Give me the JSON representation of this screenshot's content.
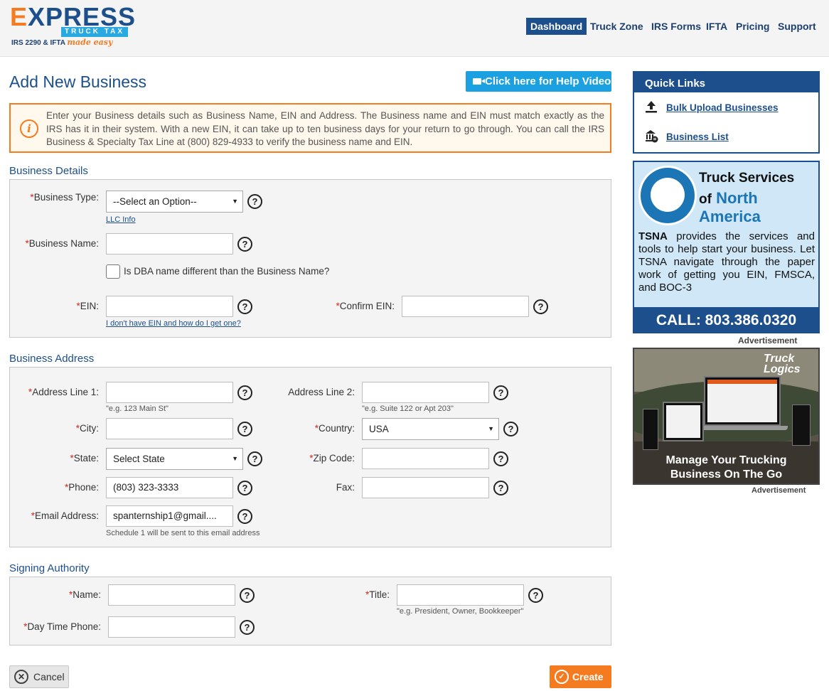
{
  "header": {
    "logo_main": "XPRESS",
    "logo_first": "E",
    "logo_band": "TRUCK TAX",
    "logo_sub": "IRS 2290 & IFTA",
    "logo_tagline": "made easy",
    "nav": [
      "Dashboard",
      "Truck Zone",
      "IRS Forms",
      "IFTA",
      "Pricing",
      "Support"
    ],
    "active_nav": "Dashboard"
  },
  "page": {
    "title": "Add New Business",
    "help_video_label": "Click here for Help Video",
    "notice": "Enter your Business details such as Business Name, EIN and Address. The Business name and EIN must match exactly as the IRS has it in their system. With a new EIN, it can take up to ten business days for your return to go through. You can call the IRS Business & Specialty Tax Line at (800) 829-4933 to verify the business name and EIN."
  },
  "business_details": {
    "heading": "Business Details",
    "business_type_label": "Business Type:",
    "business_type_value": "--Select an Option--",
    "llc_info_link": "LLC Info",
    "business_name_label": "Business Name:",
    "business_name_value": "",
    "dba_checkbox_label": "Is DBA name different than the Business Name?",
    "dba_checked": false,
    "ein_label": "EIN:",
    "ein_value": "",
    "confirm_ein_label": "Confirm EIN:",
    "confirm_ein_value": "",
    "no_ein_link": "I don't have EIN and how do I get one?"
  },
  "business_address": {
    "heading": "Business Address",
    "address1_label": "Address Line 1:",
    "address1_value": "",
    "address1_hint": "\"e.g. 123 Main St\"",
    "address2_label": "Address Line 2:",
    "address2_value": "",
    "address2_hint": "\"e.g. Suite 122 or Apt 203\"",
    "city_label": "City:",
    "city_value": "",
    "country_label": "Country:",
    "country_value": "USA",
    "state_label": "State:",
    "state_value": "Select State",
    "zip_label": "Zip Code:",
    "zip_value": "",
    "phone_label": "Phone:",
    "phone_value": "(803) 323-3333",
    "fax_label": "Fax:",
    "fax_value": "",
    "email_label": "Email Address:",
    "email_value": "spanternship1@gmail....",
    "email_hint": "Schedule 1 will be sent to this email address"
  },
  "signing_authority": {
    "heading": "Signing Authority",
    "name_label": "Name:",
    "name_value": "",
    "title_label": "Title:",
    "title_value": "",
    "title_hint": "\"e.g. President, Owner, Bookkeeper\"",
    "phone_label": "Day Time Phone:",
    "phone_value": ""
  },
  "actions": {
    "cancel_label": "Cancel",
    "create_label": "Create"
  },
  "sidebar": {
    "quick_links_title": "Quick Links",
    "links": [
      "Bulk Upload Businesses",
      "Business List"
    ],
    "ad1": {
      "title_line1": "Truck Services",
      "title_of": "of",
      "title_line2": "North America",
      "body_bold": "TSNA",
      "body": " provides the services and tools to help start your business. Let TSNA navigate through the paper work of getting you EIN, FMSCA, and BOC-3",
      "call": "CALL: 803.386.0320",
      "label": "Advertisement"
    },
    "ad2": {
      "logo_line1": "Truck",
      "logo_line2": "Logics",
      "tagline_line1": "Manage Your Trucking",
      "tagline_line2": "Business On The Go",
      "label": "Advertisement"
    }
  },
  "colors": {
    "brand_blue": "#1c4f8c",
    "accent_orange": "#f47b20",
    "help_button": "#1ba0e2",
    "required_star": "#d9261c"
  }
}
